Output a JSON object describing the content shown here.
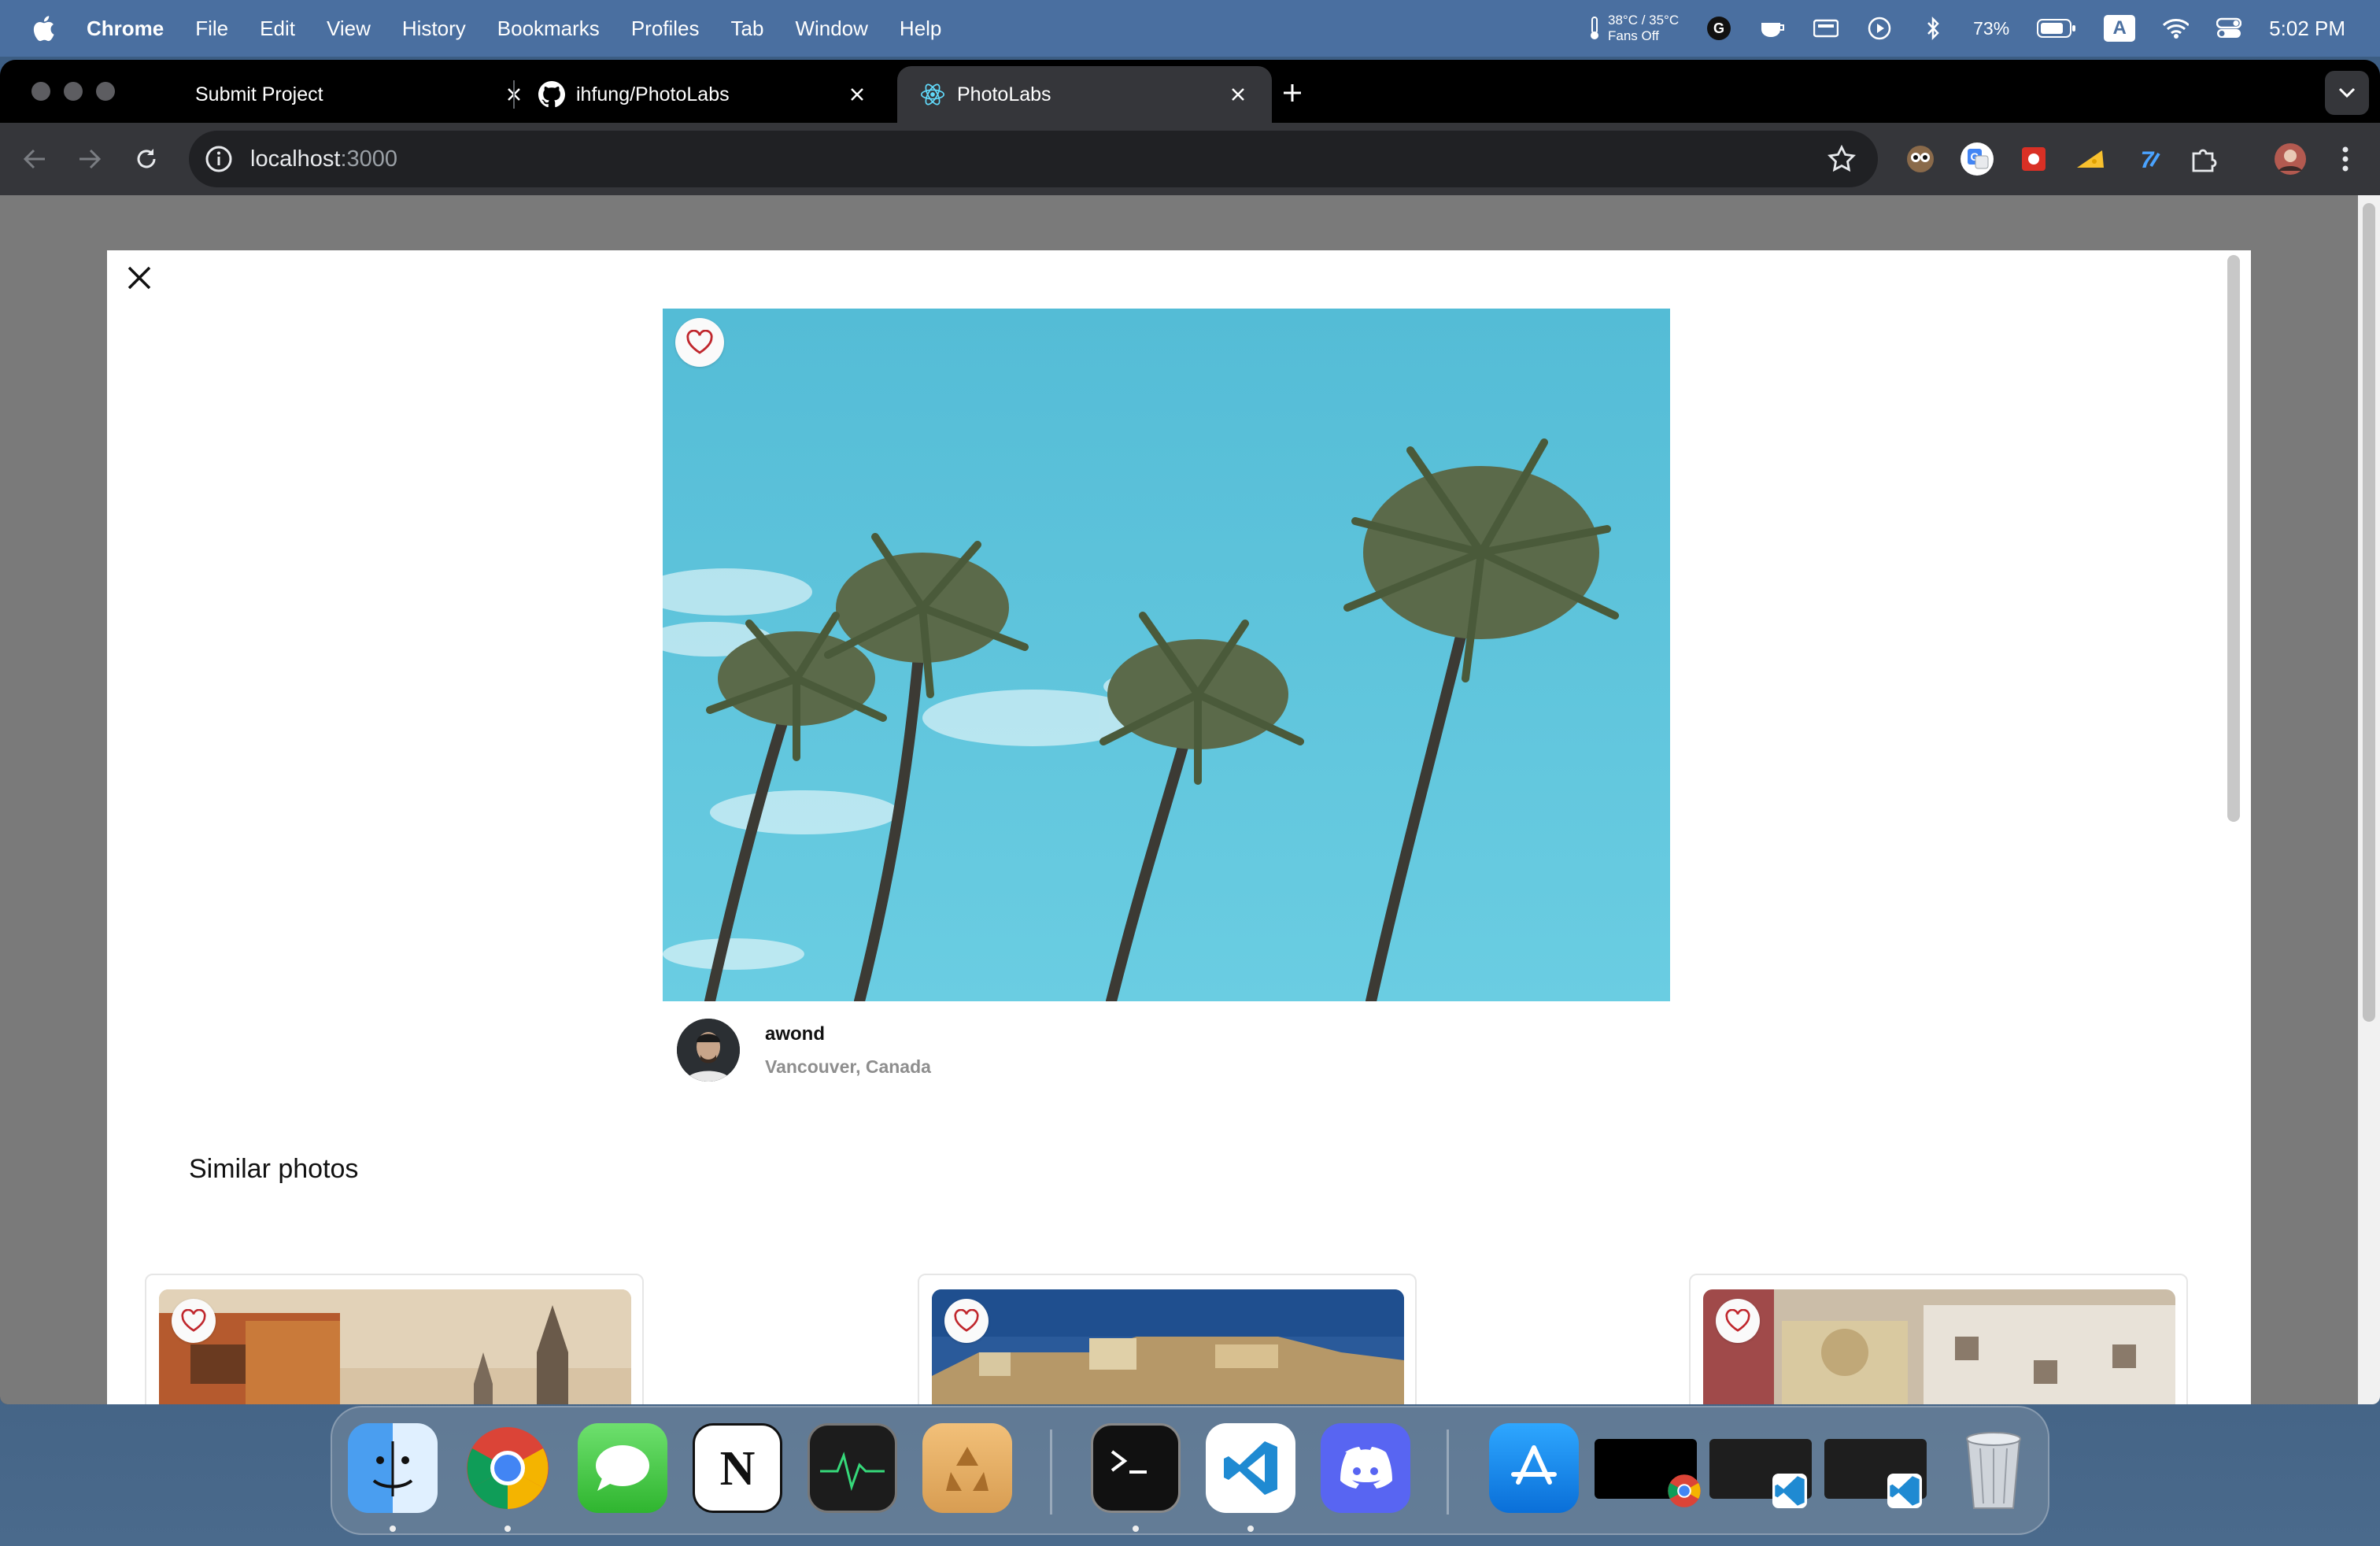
{
  "menubar": {
    "app_name": "Chrome",
    "items": [
      "File",
      "Edit",
      "View",
      "History",
      "Bookmarks",
      "Profiles",
      "Tab",
      "Window",
      "Help"
    ],
    "temperature": "38°C / 35°C",
    "fans": "Fans Off",
    "battery": "73%",
    "input_source": "A",
    "clock": "5:02 PM"
  },
  "tabs": [
    {
      "title": "Submit Project",
      "icon": "none"
    },
    {
      "title": "ihfung/PhotoLabs",
      "icon": "github-icon"
    },
    {
      "title": "PhotoLabs",
      "icon": "react-icon",
      "active": true
    }
  ],
  "address_bar": {
    "host": "localhost",
    "port": ":3000"
  },
  "modal": {
    "author": {
      "username": "awond",
      "location": "Vancouver, Canada"
    },
    "similar_title": "Similar photos"
  },
  "colors": {
    "menubar": "#4a6fa0",
    "sky": "#5fc4dc",
    "heart_outline": "#c0272d"
  },
  "dock": {
    "apps": [
      "finder-icon",
      "chrome-icon",
      "messages-icon",
      "notion-icon",
      "activity-monitor-icon",
      "recycle-app-icon",
      "terminal-icon",
      "vscode-icon",
      "discord-icon",
      "app-store-icon",
      "trash-icon"
    ]
  }
}
